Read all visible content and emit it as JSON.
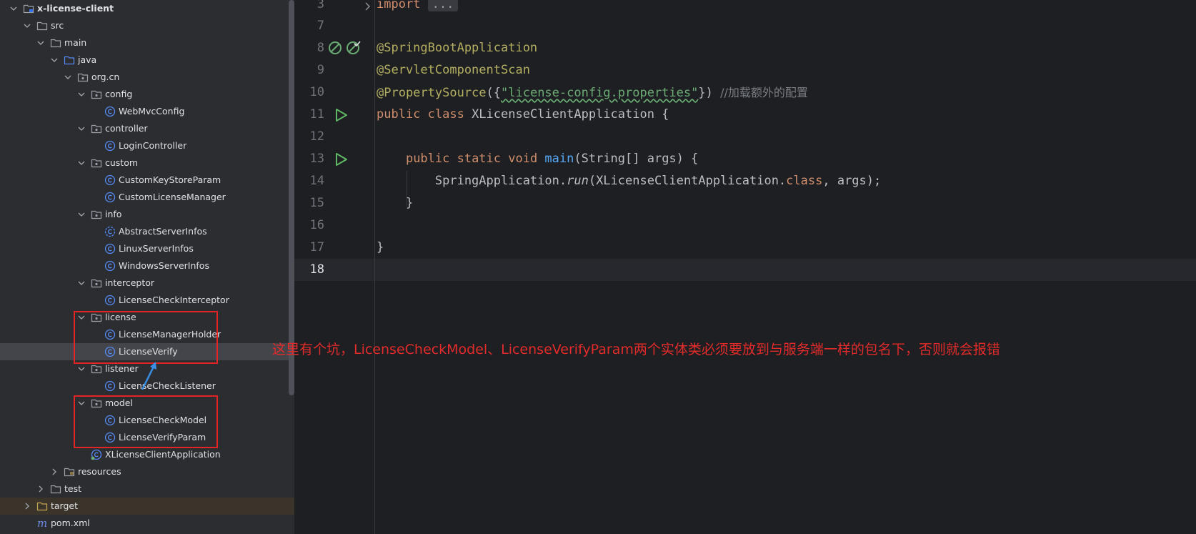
{
  "tree": {
    "items": [
      {
        "label": "x-license-client",
        "icon": "module-folder-icon",
        "expanded": true
      },
      {
        "label": "src",
        "icon": "folder-icon",
        "expanded": true
      },
      {
        "label": "main",
        "icon": "folder-icon",
        "expanded": true
      },
      {
        "label": "java",
        "icon": "source-folder-icon",
        "expanded": true
      },
      {
        "label": "org.cn",
        "icon": "package-icon",
        "expanded": true
      },
      {
        "label": "config",
        "icon": "package-icon",
        "expanded": true
      },
      {
        "label": "WebMvcConfig",
        "icon": "class-icon"
      },
      {
        "label": "controller",
        "icon": "package-icon",
        "expanded": true
      },
      {
        "label": "LoginController",
        "icon": "class-icon"
      },
      {
        "label": "custom",
        "icon": "package-icon",
        "expanded": true
      },
      {
        "label": "CustomKeyStoreParam",
        "icon": "class-icon"
      },
      {
        "label": "CustomLicenseManager",
        "icon": "class-icon"
      },
      {
        "label": "info",
        "icon": "package-icon",
        "expanded": true
      },
      {
        "label": "AbstractServerInfos",
        "icon": "abstract-class-icon"
      },
      {
        "label": "LinuxServerInfos",
        "icon": "class-icon"
      },
      {
        "label": "WindowsServerInfos",
        "icon": "class-icon"
      },
      {
        "label": "interceptor",
        "icon": "package-icon",
        "expanded": true
      },
      {
        "label": "LicenseCheckInterceptor",
        "icon": "class-icon"
      },
      {
        "label": "license",
        "icon": "package-icon",
        "expanded": true
      },
      {
        "label": "LicenseManagerHolder",
        "icon": "class-icon"
      },
      {
        "label": "LicenseVerify",
        "icon": "class-icon"
      },
      {
        "label": "listener",
        "icon": "package-icon",
        "expanded": true
      },
      {
        "label": "LicenseCheckListener",
        "icon": "class-icon"
      },
      {
        "label": "model",
        "icon": "package-icon",
        "expanded": true
      },
      {
        "label": "LicenseCheckModel",
        "icon": "class-icon"
      },
      {
        "label": "LicenseVerifyParam",
        "icon": "class-icon"
      },
      {
        "label": "XLicenseClientApplication",
        "icon": "spring-boot-class-icon"
      },
      {
        "label": "resources",
        "icon": "resources-folder-icon",
        "expanded": false
      },
      {
        "label": "test",
        "icon": "folder-icon",
        "expanded": false
      },
      {
        "label": "target",
        "icon": "excluded-folder-icon",
        "expanded": false
      },
      {
        "label": "pom.xml",
        "icon": "maven-icon"
      }
    ]
  },
  "editor": {
    "lines": [
      {
        "num": "3",
        "text": "import ..."
      },
      {
        "num": "7",
        "text": ""
      },
      {
        "num": "8",
        "text": "@SpringBootApplication"
      },
      {
        "num": "9",
        "text": "@ServletComponentScan"
      },
      {
        "num": "10",
        "text": "@PropertySource({\"license-config.properties\"}) //加载额外的配置"
      },
      {
        "num": "11",
        "text": "public class XLicenseClientApplication {"
      },
      {
        "num": "12",
        "text": ""
      },
      {
        "num": "13",
        "text": "    public static void main(String[] args) {"
      },
      {
        "num": "14",
        "text": "        SpringApplication.run(XLicenseClientApplication.class, args);"
      },
      {
        "num": "15",
        "text": "    }"
      },
      {
        "num": "16",
        "text": ""
      },
      {
        "num": "17",
        "text": "}"
      },
      {
        "num": "18",
        "text": ""
      }
    ],
    "tokens": {
      "import_kw": "import",
      "fold": "...",
      "ann1": "@SpringBootApplication",
      "ann2": "@ServletComponentScan",
      "ann3": "@PropertySource",
      "l10_open": "({",
      "l10_str": "\"license-config.properties\"",
      "l10_close": "}) ",
      "l10_comment": "//加载额外的配置",
      "l11_kw": "public class ",
      "l11_rest": "XLicenseClientApplication {",
      "l13_indent": "    ",
      "l13_kw": "public static void ",
      "l13_fn": "main",
      "l13_rest": "(String[] args) {",
      "l14_a": "        SpringApplication.",
      "l14_run": "run",
      "l14_b": "(XLicenseClientApplication.",
      "l14_class": "class",
      "l14_c": ", args);",
      "l15": "    }",
      "l17": "}"
    }
  },
  "annotation_note": "这里有个坑，LicenseCheckModel、LicenseVerifyParam两个实体类必须要放到与服务端一样的包名下，否则就会报错",
  "colors": {
    "highlight_box": "#e32424",
    "note_text": "#e22b2b",
    "arrow": "#3a8ee6"
  }
}
